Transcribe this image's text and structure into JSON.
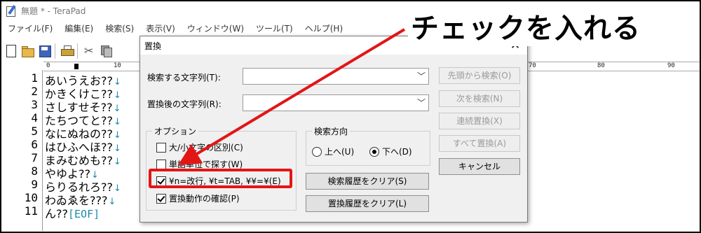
{
  "window": {
    "title": "無題 * - TeraPad"
  },
  "menu": [
    "ファイル(F)",
    "編集(E)",
    "検索(S)",
    "表示(V)",
    "ウィンドウ(W)",
    "ツール(T)",
    "ヘルプ(H)"
  ],
  "toolbar": {
    "icons": [
      "new-file-icon",
      "open-folder-icon",
      "save-icon",
      "print-icon",
      "cut-icon",
      "copy-icon"
    ]
  },
  "ruler": {
    "labels": [
      "0",
      "10",
      "70",
      "80",
      "90"
    ]
  },
  "editor": {
    "line_numbers": [
      "1",
      "2",
      "3",
      "4",
      "5",
      "6",
      "7",
      "8",
      "9",
      "10",
      "11"
    ],
    "lines": [
      "あいうえお??",
      "かきくけこ??",
      "さしすせそ??",
      "たちつてと??",
      "なにぬねの??",
      "はひふへほ??",
      "まみむめも??",
      "やゆよ??",
      "らりるれろ??",
      "わゐゑを???",
      "ん??"
    ],
    "eol_mark": "↓",
    "eof_mark": "[EOF]"
  },
  "dialog": {
    "title": "置換",
    "close": "✕",
    "search_label": "検索する文字列(T):",
    "search_value": "",
    "replace_label": "置換後の文字列(R):",
    "replace_value": "",
    "buttons": {
      "find_from_top": "先頭から検索(O)",
      "find_next": "次を検索(N)",
      "replace_continuous": "連続置換(X)",
      "replace_all": "すべて置換(A)",
      "cancel": "キャンセル",
      "clear_search_history": "検索履歴をクリア(S)",
      "clear_replace_history": "置換履歴をクリア(L)"
    },
    "options": {
      "title": "オプション",
      "case_sensitive": {
        "label": "大/小文字の区別(C)",
        "checked": false
      },
      "whole_word": {
        "label": "単語単位で探す(W)",
        "checked": false
      },
      "escape_seq": {
        "label": "¥n=改行, ¥t=TAB, ¥¥=¥(E)",
        "checked": true
      },
      "confirm_replace": {
        "label": "置換動作の確認(P)",
        "checked": true
      }
    },
    "direction": {
      "title": "検索方向",
      "up": "上へ(U)",
      "down": "下へ(D)",
      "selected": "down"
    }
  },
  "annotation": {
    "text": "チェックを入れる",
    "color": "#e21616"
  }
}
